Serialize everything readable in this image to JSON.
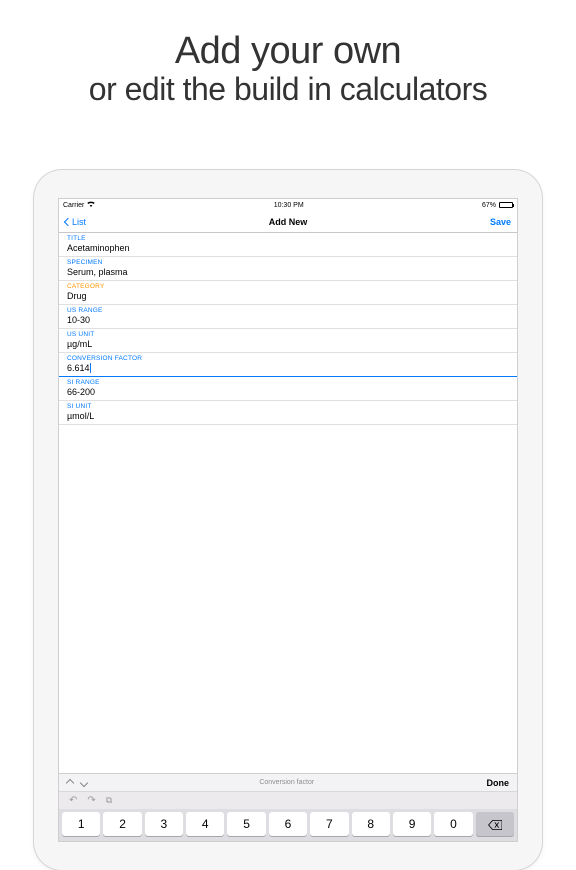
{
  "headline": {
    "line1": "Add your own",
    "line2": "or edit the build in calculators"
  },
  "status": {
    "carrier": "Carrier",
    "time": "10:30 PM",
    "battery_pct": "67%"
  },
  "nav": {
    "back_label": "List",
    "title": "Add New",
    "save_label": "Save"
  },
  "fields": {
    "title": {
      "label": "TITLE",
      "value": "Acetaminophen"
    },
    "specimen": {
      "label": "SPECIMEN",
      "value": "Serum, plasma"
    },
    "category": {
      "label": "CATEGORY",
      "value": "Drug"
    },
    "us_range": {
      "label": "US RANGE",
      "value": "10-30"
    },
    "us_unit": {
      "label": "US UNIT",
      "value": "µg/mL"
    },
    "conversion_factor": {
      "label": "CONVERSION FACTOR",
      "value": "6.614"
    },
    "si_range": {
      "label": "SI RANGE",
      "value": "66-200"
    },
    "si_unit": {
      "label": "SI UNIT",
      "value": "µmol/L"
    }
  },
  "accessory": {
    "hint": "Conversion factor",
    "done": "Done"
  },
  "keyboard": {
    "keys": [
      "1",
      "2",
      "3",
      "4",
      "5",
      "6",
      "7",
      "8",
      "9",
      "0"
    ]
  }
}
